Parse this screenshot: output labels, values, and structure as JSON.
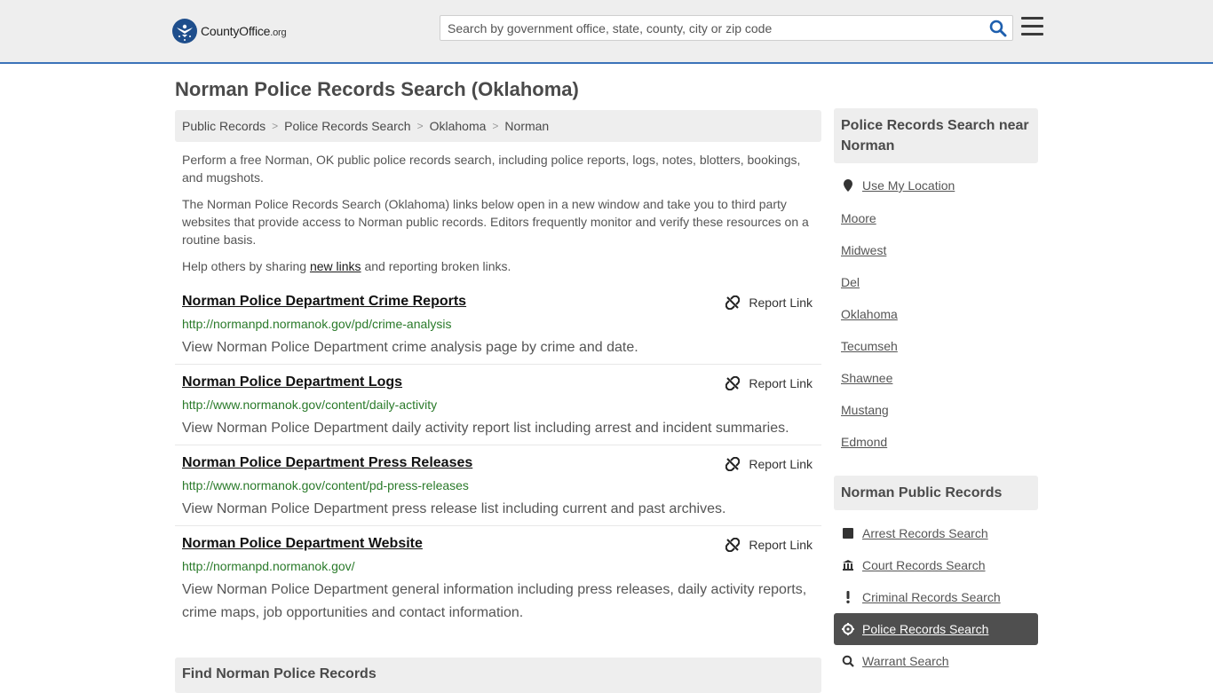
{
  "header": {
    "logo_main": "CountyOffice",
    "logo_tld": ".org",
    "search_placeholder": "Search by government office, state, county, city or zip code"
  },
  "page": {
    "title": "Norman Police Records Search (Oklahoma)"
  },
  "breadcrumb": [
    "Public Records",
    "Police Records Search",
    "Oklahoma",
    "Norman"
  ],
  "intro": {
    "p1": "Perform a free Norman, OK public police records search, including police reports, logs, notes, blotters, bookings, and mugshots.",
    "p2": "The Norman Police Records Search (Oklahoma) links below open in a new window and take you to third party websites that provide access to Norman public records. Editors frequently monitor and verify these resources on a routine basis.",
    "p3_before": "Help others by sharing ",
    "p3_link": "new links",
    "p3_after": " and reporting broken links."
  },
  "report_label": "Report Link",
  "results": [
    {
      "title": "Norman Police Department Crime Reports",
      "url": "http://normanpd.normanok.gov/pd/crime-analysis",
      "desc": "View Norman Police Department crime analysis page by crime and date."
    },
    {
      "title": "Norman Police Department Logs",
      "url": "http://www.normanok.gov/content/daily-activity",
      "desc": "View Norman Police Department daily activity report list including arrest and incident summaries."
    },
    {
      "title": "Norman Police Department Press Releases",
      "url": "http://www.normanok.gov/content/pd-press-releases",
      "desc": "View Norman Police Department press release list including current and past archives."
    },
    {
      "title": "Norman Police Department Website",
      "url": "http://normanpd.normanok.gov/",
      "desc": "View Norman Police Department general information including press releases, daily activity reports, crime maps, job opportunities and contact information."
    }
  ],
  "find_heading": "Find Norman Police Records",
  "sidebar": {
    "near_heading": "Police Records Search near Norman",
    "use_location": "Use My Location",
    "near_links": [
      "Moore",
      "Midwest",
      "Del",
      "Oklahoma",
      "Tecumseh",
      "Shawnee",
      "Mustang",
      "Edmond"
    ],
    "records_heading": "Norman Public Records",
    "records_links": [
      {
        "label": "Arrest Records Search",
        "icon": "square-icon",
        "active": false
      },
      {
        "label": "Court Records Search",
        "icon": "courthouse-icon",
        "active": false
      },
      {
        "label": "Criminal Records Search",
        "icon": "exclamation-icon",
        "active": false
      },
      {
        "label": "Police Records Search",
        "icon": "crosshair-icon",
        "active": true
      },
      {
        "label": "Warrant Search",
        "icon": "magnifier-icon",
        "active": false
      }
    ]
  },
  "colors": {
    "accent_border": "#3b73b9",
    "url_green": "#2a7a2a",
    "active_item_bg": "#4f4f4f",
    "panel_bg": "#eeeeee"
  }
}
